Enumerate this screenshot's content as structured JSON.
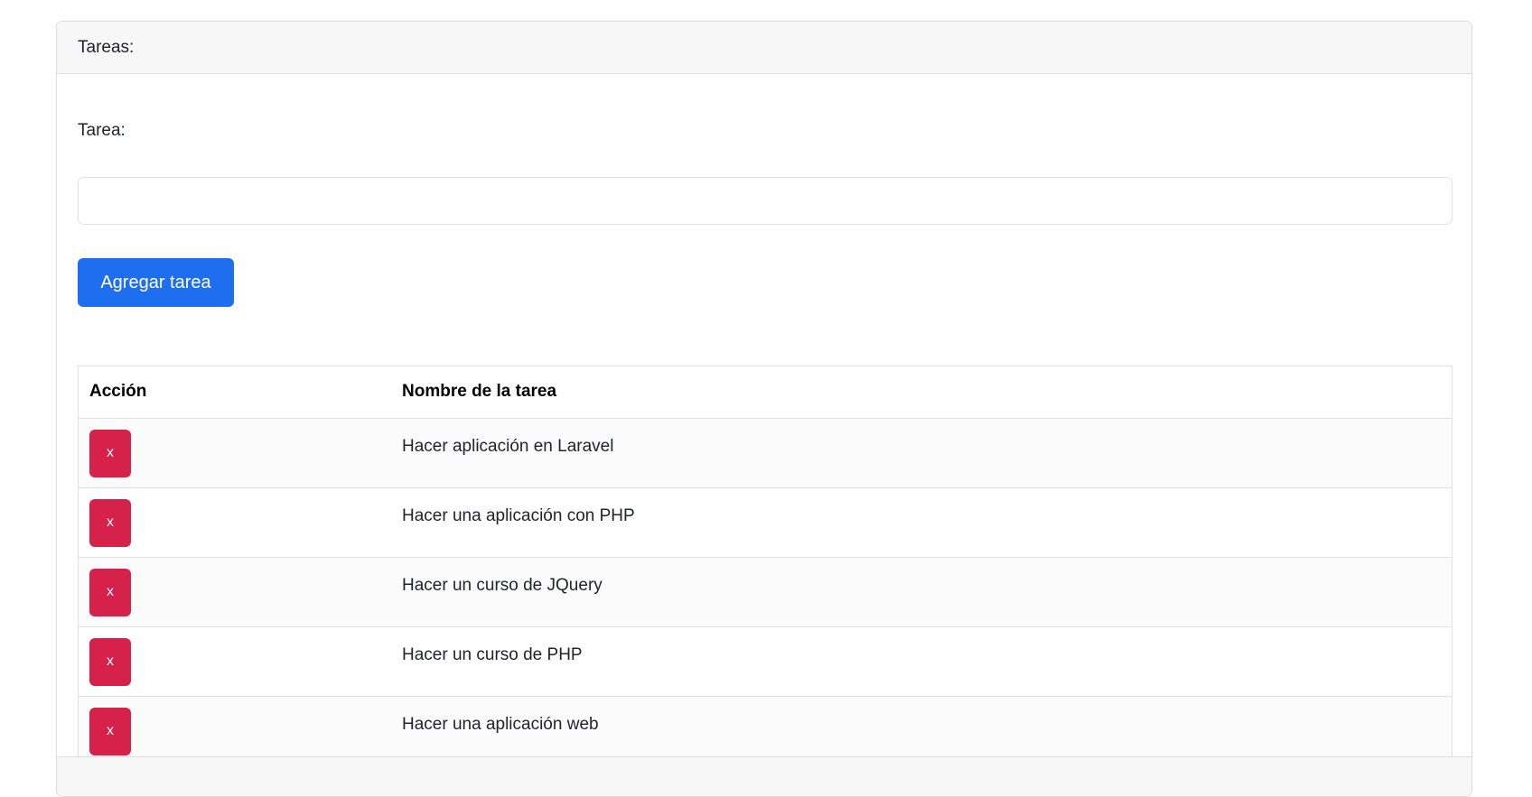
{
  "card": {
    "header_title": "Tareas:"
  },
  "form": {
    "field_label": "Tarea:",
    "input_value": "",
    "input_placeholder": "",
    "add_button_label": "Agregar tarea"
  },
  "table": {
    "headers": {
      "action": "Acción",
      "name": "Nombre de la tarea"
    },
    "rows": [
      {
        "delete_label": "x",
        "name": "Hacer aplicación en Laravel"
      },
      {
        "delete_label": "x",
        "name": "Hacer una aplicación con PHP"
      },
      {
        "delete_label": "x",
        "name": "Hacer un curso de JQuery"
      },
      {
        "delete_label": "x",
        "name": "Hacer un curso de PHP"
      },
      {
        "delete_label": "x",
        "name": "Hacer una aplicación web"
      }
    ]
  },
  "colors": {
    "primary": "#1e6ff0",
    "danger": "#d6214a",
    "header_bg": "#f7f7f7"
  }
}
